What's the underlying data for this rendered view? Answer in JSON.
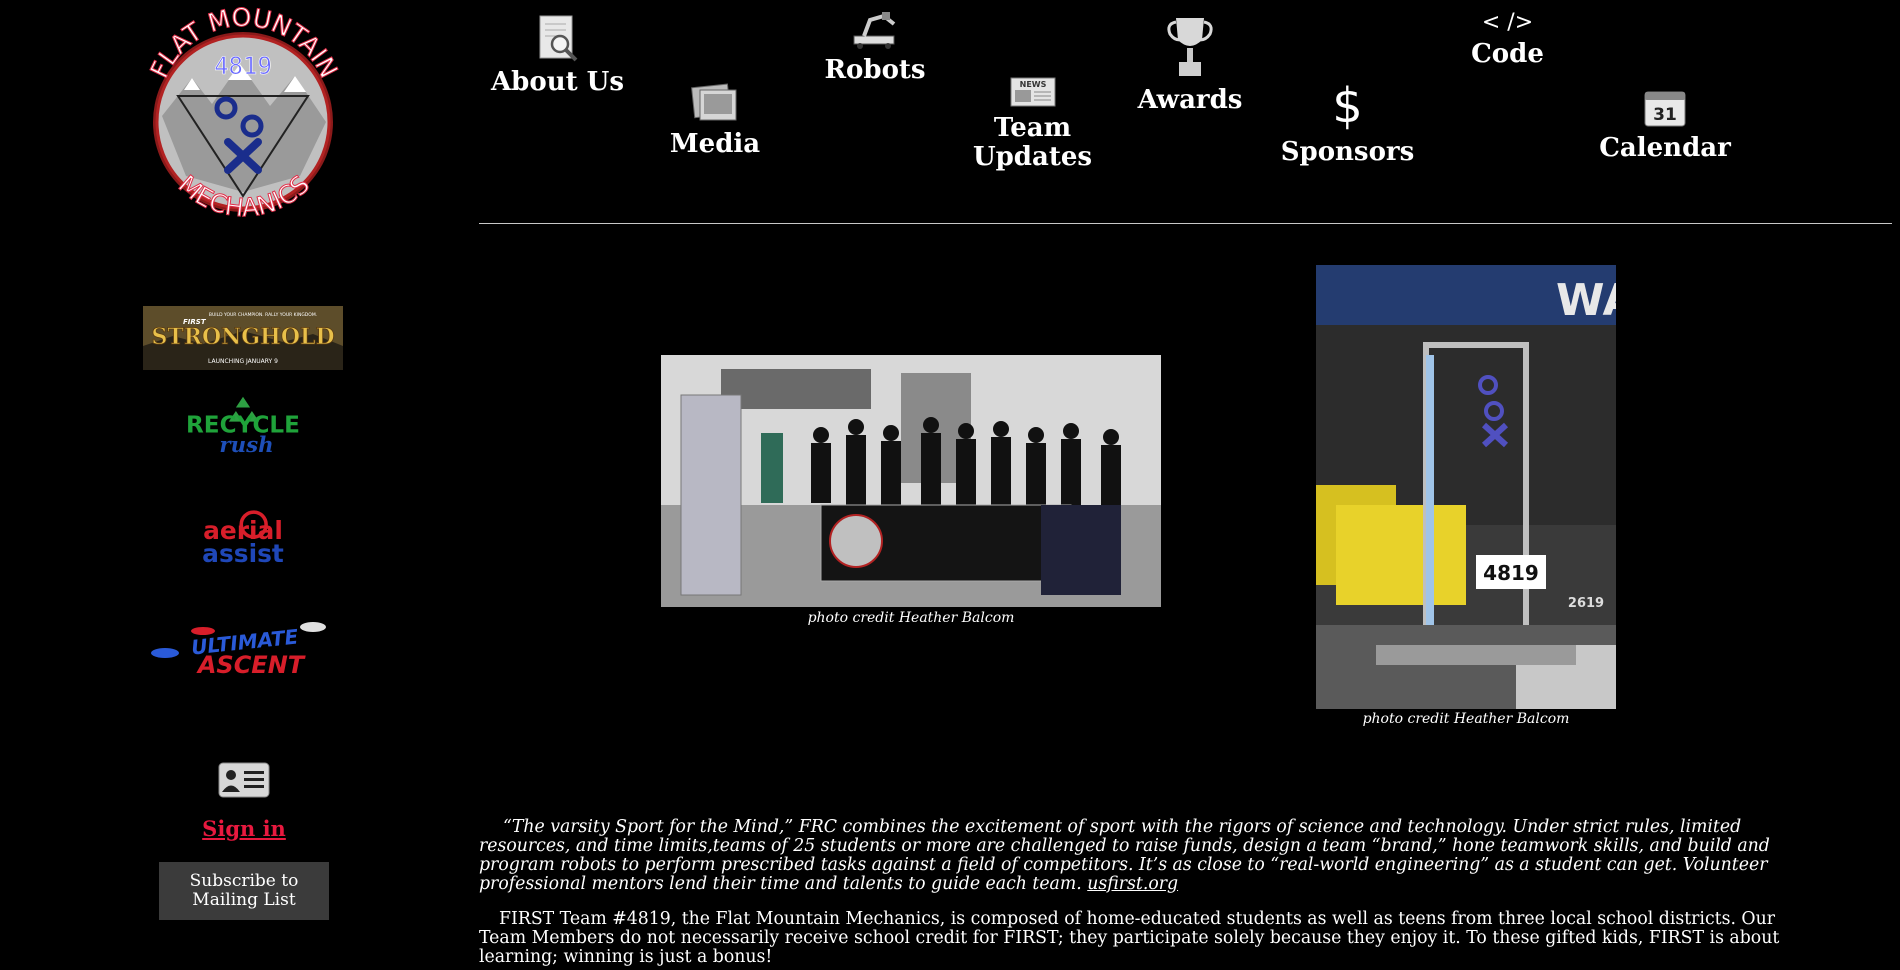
{
  "logo": {
    "top_text": "FLAT MOUNTAIN",
    "number": "4819",
    "bottom_text": "MECHANICS"
  },
  "nav": {
    "about": {
      "label": "About Us",
      "icon": "magnifier-document-icon"
    },
    "media": {
      "label": "Media",
      "icon": "photos-icon"
    },
    "robots": {
      "label": "Robots",
      "icon": "robot-icon"
    },
    "updates": {
      "label_line1": "Team",
      "label_line2": "Updates",
      "icon": "newspaper-icon",
      "icon_text": "NEWS"
    },
    "awards": {
      "label": "Awards",
      "icon": "trophy-icon"
    },
    "sponsors": {
      "label": "Sponsors",
      "icon": "dollar-icon",
      "icon_text": "$"
    },
    "code": {
      "label": "Code",
      "icon": "code-brackets-icon",
      "icon_text": "< />"
    },
    "calendar": {
      "label": "Calendar",
      "icon": "calendar-icon",
      "icon_text": "31"
    }
  },
  "banners": {
    "stronghold": {
      "top": "BUILD YOUR CHAMPION. RALLY YOUR KINGDOM.",
      "brand": "FIRST",
      "title": "STRONGHOLD",
      "bottom": "LAUNCHING JANUARY 9"
    },
    "recycle": {
      "line1": "RECYCLE",
      "line2": "rush"
    },
    "aerial": {
      "line1": "aerial",
      "line2": "assist"
    },
    "ultimate": {
      "line1": "ULTIMATE",
      "line2": "ASCENT"
    }
  },
  "sidebar": {
    "card_icon": "id-card-icon",
    "sign_in": "Sign in",
    "subscribe_line1": "Subscribe to",
    "subscribe_line2": "Mailing List"
  },
  "photos": {
    "team_caption": "photo credit Heather Balcom",
    "robot_caption": "photo credit Heather Balcom",
    "robot_number": "4819",
    "other_robot_number": "2619",
    "arena_banner": "WATE"
  },
  "content": {
    "quote": "“The varsity Sport for the Mind,” FRC combines the excitement of sport with the rigors of science and technology. Under strict rules, limited resources, and time limits,teams of 25 students or more are challenged to raise funds, design a team “brand,” hone teamwork skills, and build and program robots to perform prescribed tasks against a field of competitors.  It’s as close to “real-world engineering” as a student can get. Volunteer professional mentors lend their time and talents to guide each team.",
    "link_text": "usfirst.org",
    "team_paragraph": "FIRST Team #4819, the Flat Mountain Mechanics, is composed of home-educated students as well as teens from three local school districts. Our Team Members do not necessarily receive school credit for FIRST; they participate solely because they enjoy it. To these gifted kids, FIRST is about learning; winning is just a bonus!"
  },
  "colors": {
    "background": "#000000",
    "sign_in": "#e8193f",
    "subscribe_bg": "#3b3b3b"
  }
}
